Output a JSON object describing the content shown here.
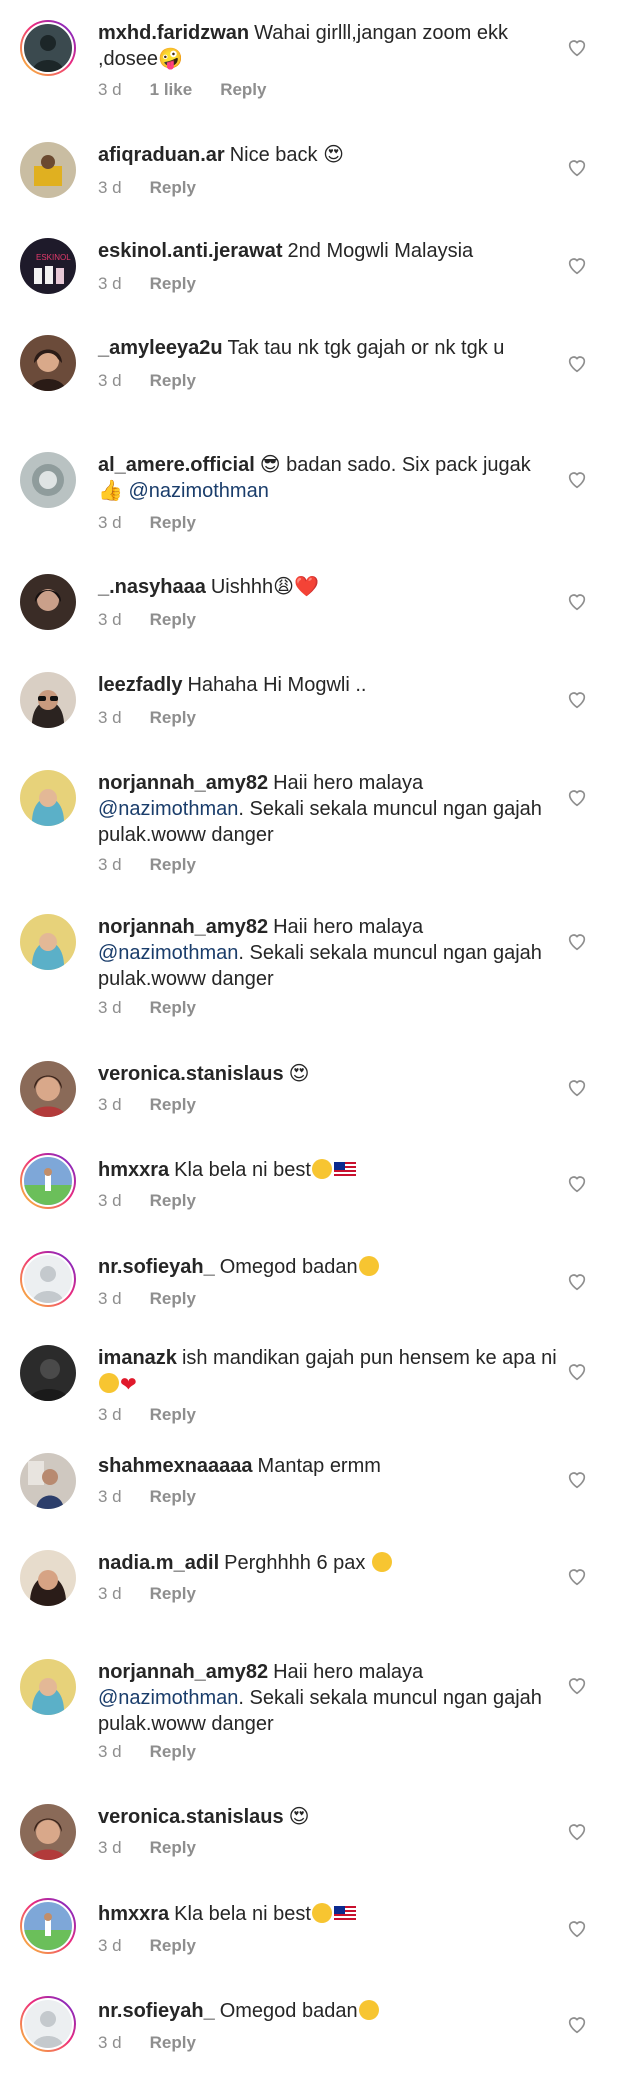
{
  "labels": {
    "reply": "Reply"
  },
  "comments": [
    {
      "username": "mxhd.faridzwan",
      "text": "Wahai girlll,jangan zoom ekk ,dosee",
      "emojis": "🤪",
      "time": "3 d",
      "likes": "1 like"
    },
    {
      "username": "afiqraduan.ar",
      "text": "Nice back",
      "emojis": "😍",
      "time": "3 d"
    },
    {
      "username": "eskinol.anti.jerawat",
      "text": "2nd Mogwli Malaysia",
      "time": "3 d"
    },
    {
      "username": "_amyleeya2u",
      "text": "Tak tau nk tgk gajah or nk tgk u",
      "time": "3 d"
    },
    {
      "username": "al_amere.official",
      "pre_emoji": "😎",
      "text": "badan sado. Six pack jugak",
      "thumb": "👍",
      "mention": "@nazimothman",
      "time": "3 d"
    },
    {
      "username": "_.nasyhaaa",
      "text": "Uishhh",
      "emojis": "😩❤️",
      "time": "3 d"
    },
    {
      "username": "leezfadly",
      "text": "Hahaha Hi Mogwli ..",
      "time": "3 d"
    },
    {
      "username": "norjannah_amy82",
      "text": "Haii hero malaya",
      "mention": "@nazimothman",
      "text2": ". Sekali sekala muncul ngan gajah pulak",
      "text3": ".woww danger",
      "time": "3 d"
    },
    {
      "username": "norjannah_amy82",
      "text": "Haii hero malaya",
      "mention": "@nazimothman",
      "text2": ". Sekali sekala muncul ngan gajah pulak",
      "text3": ".woww danger",
      "time": "3 d"
    },
    {
      "username": "veronica.stanislaus",
      "text": "",
      "emojis": "😍",
      "time": "3 d"
    },
    {
      "username": "hmxxra",
      "text": "Kla bela ni best",
      "time": "3 d"
    },
    {
      "username": "nr.sofieyah_",
      "text": "Omegod badan",
      "time": "3 d"
    },
    {
      "username": "imanazk",
      "text": "ish mandikan gajah pun hensem ke apa ni",
      "time": "3 d"
    },
    {
      "username": "shahmexnaaaaa",
      "text": "Mantap ermm",
      "time": "3 d"
    },
    {
      "username": "nadia.m_adil",
      "text": "Perghhhh 6 pax",
      "time": "3 d"
    },
    {
      "username": "norjannah_amy82",
      "text": "Haii hero malaya",
      "mention": "@nazimothman",
      "text2": ". Sekali sekala muncul ngan gajah pulak",
      "text3": ".woww danger",
      "time": "3 d"
    },
    {
      "username": "veronica.stanislaus",
      "text": "",
      "emojis": "😍",
      "time": "3 d"
    },
    {
      "username": "hmxxra",
      "text": "Kla bela ni best",
      "time": "3 d"
    },
    {
      "username": "nr.sofieyah_",
      "text": "Omegod badan",
      "time": "3 d"
    }
  ],
  "colors": {
    "username": "#262626",
    "meta": "#8e8e8e",
    "mention": "#1a3d6b",
    "ring_start": "#f9ce34",
    "ring_mid": "#ee2a7b",
    "ring_end": "#6228d7"
  }
}
